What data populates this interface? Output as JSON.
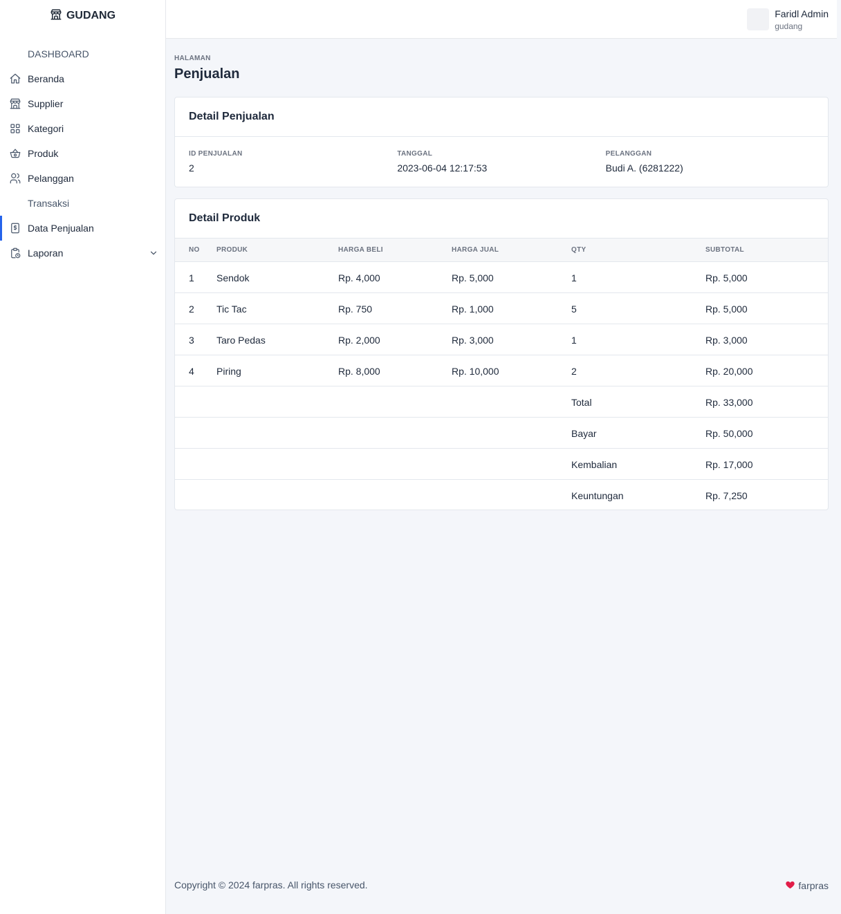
{
  "brand": {
    "name": "GUDANG",
    "icon": "store-icon"
  },
  "sidebar": {
    "sections": [
      {
        "label": "DASHBOARD"
      },
      {
        "label": "Transaksi"
      }
    ],
    "items": [
      {
        "label": "Beranda",
        "icon": "home-icon"
      },
      {
        "label": "Supplier",
        "icon": "store-icon"
      },
      {
        "label": "Kategori",
        "icon": "grid-icon"
      },
      {
        "label": "Produk",
        "icon": "basket-icon"
      },
      {
        "label": "Pelanggan",
        "icon": "users-icon"
      },
      {
        "label": "Data Penjualan",
        "icon": "receipt-icon",
        "active": true
      },
      {
        "label": "Laporan",
        "icon": "clipboard-clock-icon",
        "expandable": true
      }
    ]
  },
  "user": {
    "name": "Faridl Admin",
    "role": "gudang"
  },
  "page": {
    "pretitle": "HALAMAN",
    "title": "Penjualan"
  },
  "sale_detail": {
    "title": "Detail Penjualan",
    "fields": [
      {
        "label": "ID PENJUALAN",
        "value": "2"
      },
      {
        "label": "TANGGAL",
        "value": "2023-06-04 12:17:53"
      },
      {
        "label": "PELANGGAN",
        "value": "Budi A. (6281222)"
      }
    ]
  },
  "product_detail": {
    "title": "Detail Produk",
    "columns": [
      "NO",
      "PRODUK",
      "HARGA BELI",
      "HARGA JUAL",
      "QTY",
      "SUBTOTAL"
    ],
    "rows": [
      [
        "1",
        "Sendok",
        "Rp. 4,000",
        "Rp. 5,000",
        "1",
        "Rp. 5,000"
      ],
      [
        "2",
        "Tic Tac",
        "Rp. 750",
        "Rp. 1,000",
        "5",
        "Rp. 5,000"
      ],
      [
        "3",
        "Taro Pedas",
        "Rp. 2,000",
        "Rp. 3,000",
        "1",
        "Rp. 3,000"
      ],
      [
        "4",
        "Piring",
        "Rp. 8,000",
        "Rp. 10,000",
        "2",
        "Rp. 20,000"
      ]
    ],
    "summary": [
      {
        "label": "Total",
        "value": "Rp. 33,000"
      },
      {
        "label": "Bayar",
        "value": "Rp. 50,000"
      },
      {
        "label": "Kembalian",
        "value": "Rp. 17,000"
      },
      {
        "label": "Keuntungan",
        "value": "Rp. 7,250"
      }
    ]
  },
  "footer": {
    "copyright": "Copyright © 2024 farpras. All rights reserved.",
    "credit": "farpras",
    "heart_color": "#e11d48"
  },
  "colors": {
    "accent": "#2563eb",
    "background": "#f4f6fa"
  }
}
